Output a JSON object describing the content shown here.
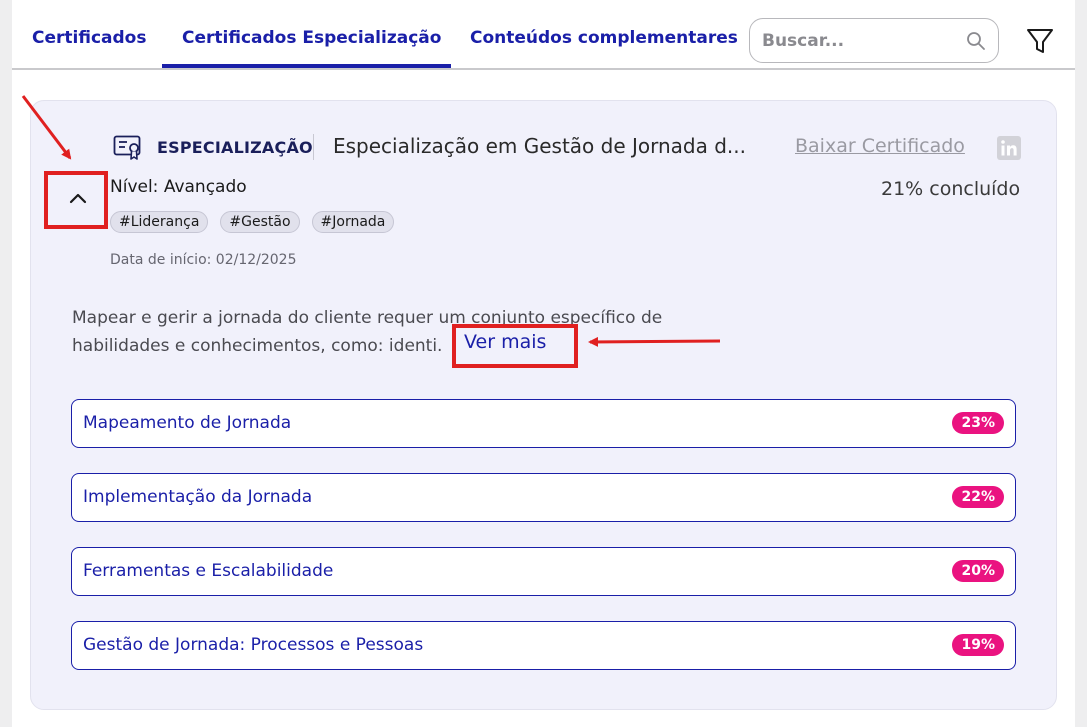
{
  "tabs": [
    {
      "label": "Certificados",
      "active": false
    },
    {
      "label": "Certificados Especialização",
      "active": true
    },
    {
      "label": "Conteúdos complementares",
      "active": false
    }
  ],
  "search": {
    "placeholder": "Buscar...",
    "icon": "search-icon"
  },
  "filter": {
    "icon": "filter-icon"
  },
  "card": {
    "type_label": "ESPECIALIZAÇÃO",
    "title": "Especialização em Gestão de Jornada d...",
    "download_label": "Baixar Certificado",
    "level": "Nível: Avançado",
    "progress_text": "21% concluído",
    "tags": [
      "#Liderança",
      "#Gestão",
      "#Jornada"
    ],
    "start_date": "Data de início: 02/12/2025",
    "description": "Mapear e gerir a jornada do cliente requer um conjunto específico de habilidades e conhecimentos, como: identi.",
    "see_more_label": "Ver mais",
    "modules": [
      {
        "name": "Mapeamento de Jornada",
        "percent": "23%"
      },
      {
        "name": "Implementação da Jornada",
        "percent": "22%"
      },
      {
        "name": "Ferramentas e Escalabilidade",
        "percent": "20%"
      },
      {
        "name": "Gestão de Jornada: Processos e Pessoas",
        "percent": "19%"
      }
    ]
  },
  "colors": {
    "primary": "#1a1fa8",
    "badge": "#ea1380",
    "card_bg": "#f1f1fb",
    "annotation": "#e02020"
  }
}
